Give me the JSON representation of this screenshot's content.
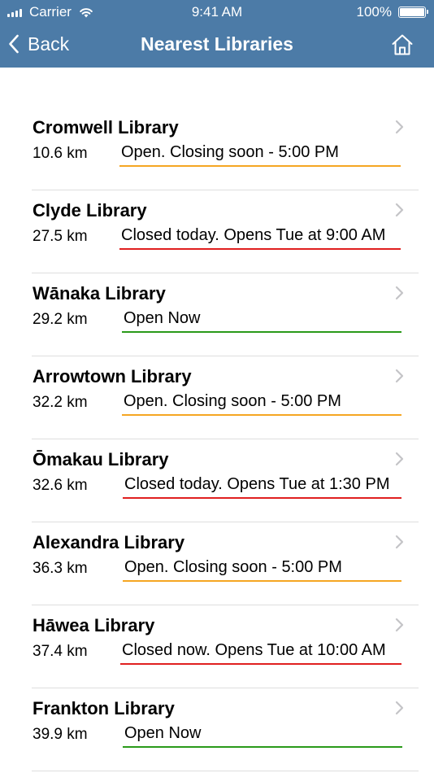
{
  "status_bar": {
    "carrier": "Carrier",
    "time": "9:41 AM",
    "battery": "100%",
    "battery_level": 1.0
  },
  "nav": {
    "back_label": "Back",
    "title": "Nearest Libraries"
  },
  "colors": {
    "header": "#4c7ba7",
    "closing_soon": "#f5a623",
    "closed": "#e02020",
    "open": "#2a9a1a"
  },
  "libraries": [
    {
      "name": "Cromwell Library",
      "distance": "10.6 km",
      "status": "Open. Closing soon - 5:00 PM",
      "status_type": "closing_soon"
    },
    {
      "name": "Clyde Library",
      "distance": "27.5 km",
      "status": "Closed today. Opens Tue at 9:00 AM",
      "status_type": "closed"
    },
    {
      "name": "Wānaka Library",
      "distance": "29.2 km",
      "status": "Open Now",
      "status_type": "open"
    },
    {
      "name": "Arrowtown Library",
      "distance": "32.2 km",
      "status": "Open. Closing soon - 5:00 PM",
      "status_type": "closing_soon"
    },
    {
      "name": "Ōmakau Library",
      "distance": "32.6 km",
      "status": "Closed today. Opens Tue at 1:30 PM",
      "status_type": "closed"
    },
    {
      "name": "Alexandra Library",
      "distance": "36.3 km",
      "status": "Open. Closing soon - 5:00 PM",
      "status_type": "closing_soon"
    },
    {
      "name": "Hāwea Library",
      "distance": "37.4 km",
      "status": "Closed now. Opens Tue at 10:00 AM",
      "status_type": "closed"
    },
    {
      "name": "Frankton Library",
      "distance": "39.9 km",
      "status": "Open Now",
      "status_type": "open"
    }
  ]
}
